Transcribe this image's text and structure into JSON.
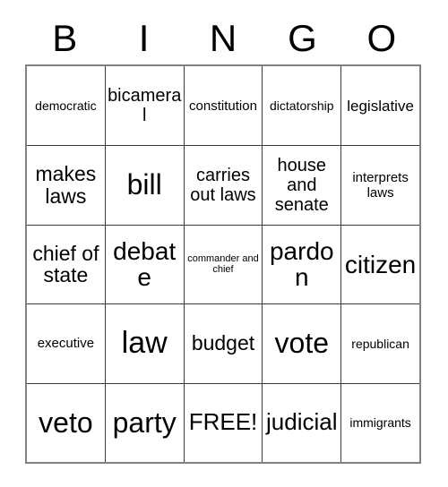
{
  "card": {
    "title_letters": [
      "B",
      "I",
      "N",
      "G",
      "O"
    ],
    "free_space_label": "FREE!",
    "colors": {
      "text": "#000000",
      "background": "#ffffff",
      "outer_border": "#808080",
      "inner_border": "#3a3a3a"
    },
    "rows": [
      [
        {
          "text": "democratic",
          "size": "sm"
        },
        {
          "text": "bicameral",
          "size": "lg"
        },
        {
          "text": "constitution",
          "size": "smd"
        },
        {
          "text": "dictatorship",
          "size": "sm"
        },
        {
          "text": "legislative",
          "size": "md"
        }
      ],
      [
        {
          "text": "makes laws",
          "size": "xl"
        },
        {
          "text": "bill",
          "size": "4xl"
        },
        {
          "text": "carries out laws",
          "size": "lg"
        },
        {
          "text": "house and senate",
          "size": "lg"
        },
        {
          "text": "interprets laws",
          "size": "smd"
        }
      ],
      [
        {
          "text": "chief of state",
          "size": "xl"
        },
        {
          "text": "debate",
          "size": "3xl"
        },
        {
          "text": "commander and chief",
          "size": "xs"
        },
        {
          "text": "pardon",
          "size": "3xl"
        },
        {
          "text": "citizen",
          "size": "3xl"
        }
      ],
      [
        {
          "text": "executive",
          "size": "smd"
        },
        {
          "text": "law",
          "size": "5xl"
        },
        {
          "text": "budget",
          "size": "xl"
        },
        {
          "text": "vote",
          "size": "4xl"
        },
        {
          "text": "republican",
          "size": "sm"
        }
      ],
      [
        {
          "text": "veto",
          "size": "4xl"
        },
        {
          "text": "party",
          "size": "4xl"
        },
        {
          "text": "FREE!",
          "size": "2xl"
        },
        {
          "text": "judicial",
          "size": "2xl"
        },
        {
          "text": "immigrants",
          "size": "sm"
        }
      ]
    ]
  }
}
